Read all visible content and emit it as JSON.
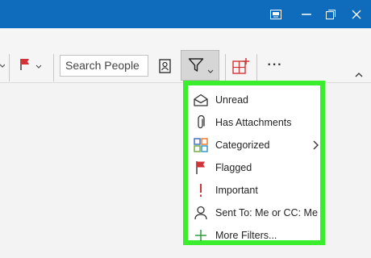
{
  "colors": {
    "titlebar": "#0f6cbd",
    "highlight_border": "#3aee2e",
    "flag_red": "#d13438",
    "important_red": "#d13438",
    "add_green": "#2e9a3a"
  },
  "window_controls": [
    "restore-window-icon",
    "minimize-icon",
    "maximize-icon",
    "close-icon"
  ],
  "toolbar": {
    "search_people_placeholder": "Search People",
    "more_label": "···",
    "collapse_label": "^"
  },
  "filter_menu": {
    "items": [
      {
        "label": "Unread",
        "icon": "envelope-icon"
      },
      {
        "label": "Has Attachments",
        "icon": "paperclip-icon"
      },
      {
        "label": "Categorized",
        "icon": "categories-icon",
        "submenu": ">"
      },
      {
        "label": "Flagged",
        "icon": "flag-icon"
      },
      {
        "label": "Important",
        "icon": "important-icon"
      },
      {
        "label": "Sent To: Me or CC: Me",
        "icon": "person-icon"
      },
      {
        "label": "More Filters...",
        "icon": "plus-icon"
      }
    ]
  }
}
